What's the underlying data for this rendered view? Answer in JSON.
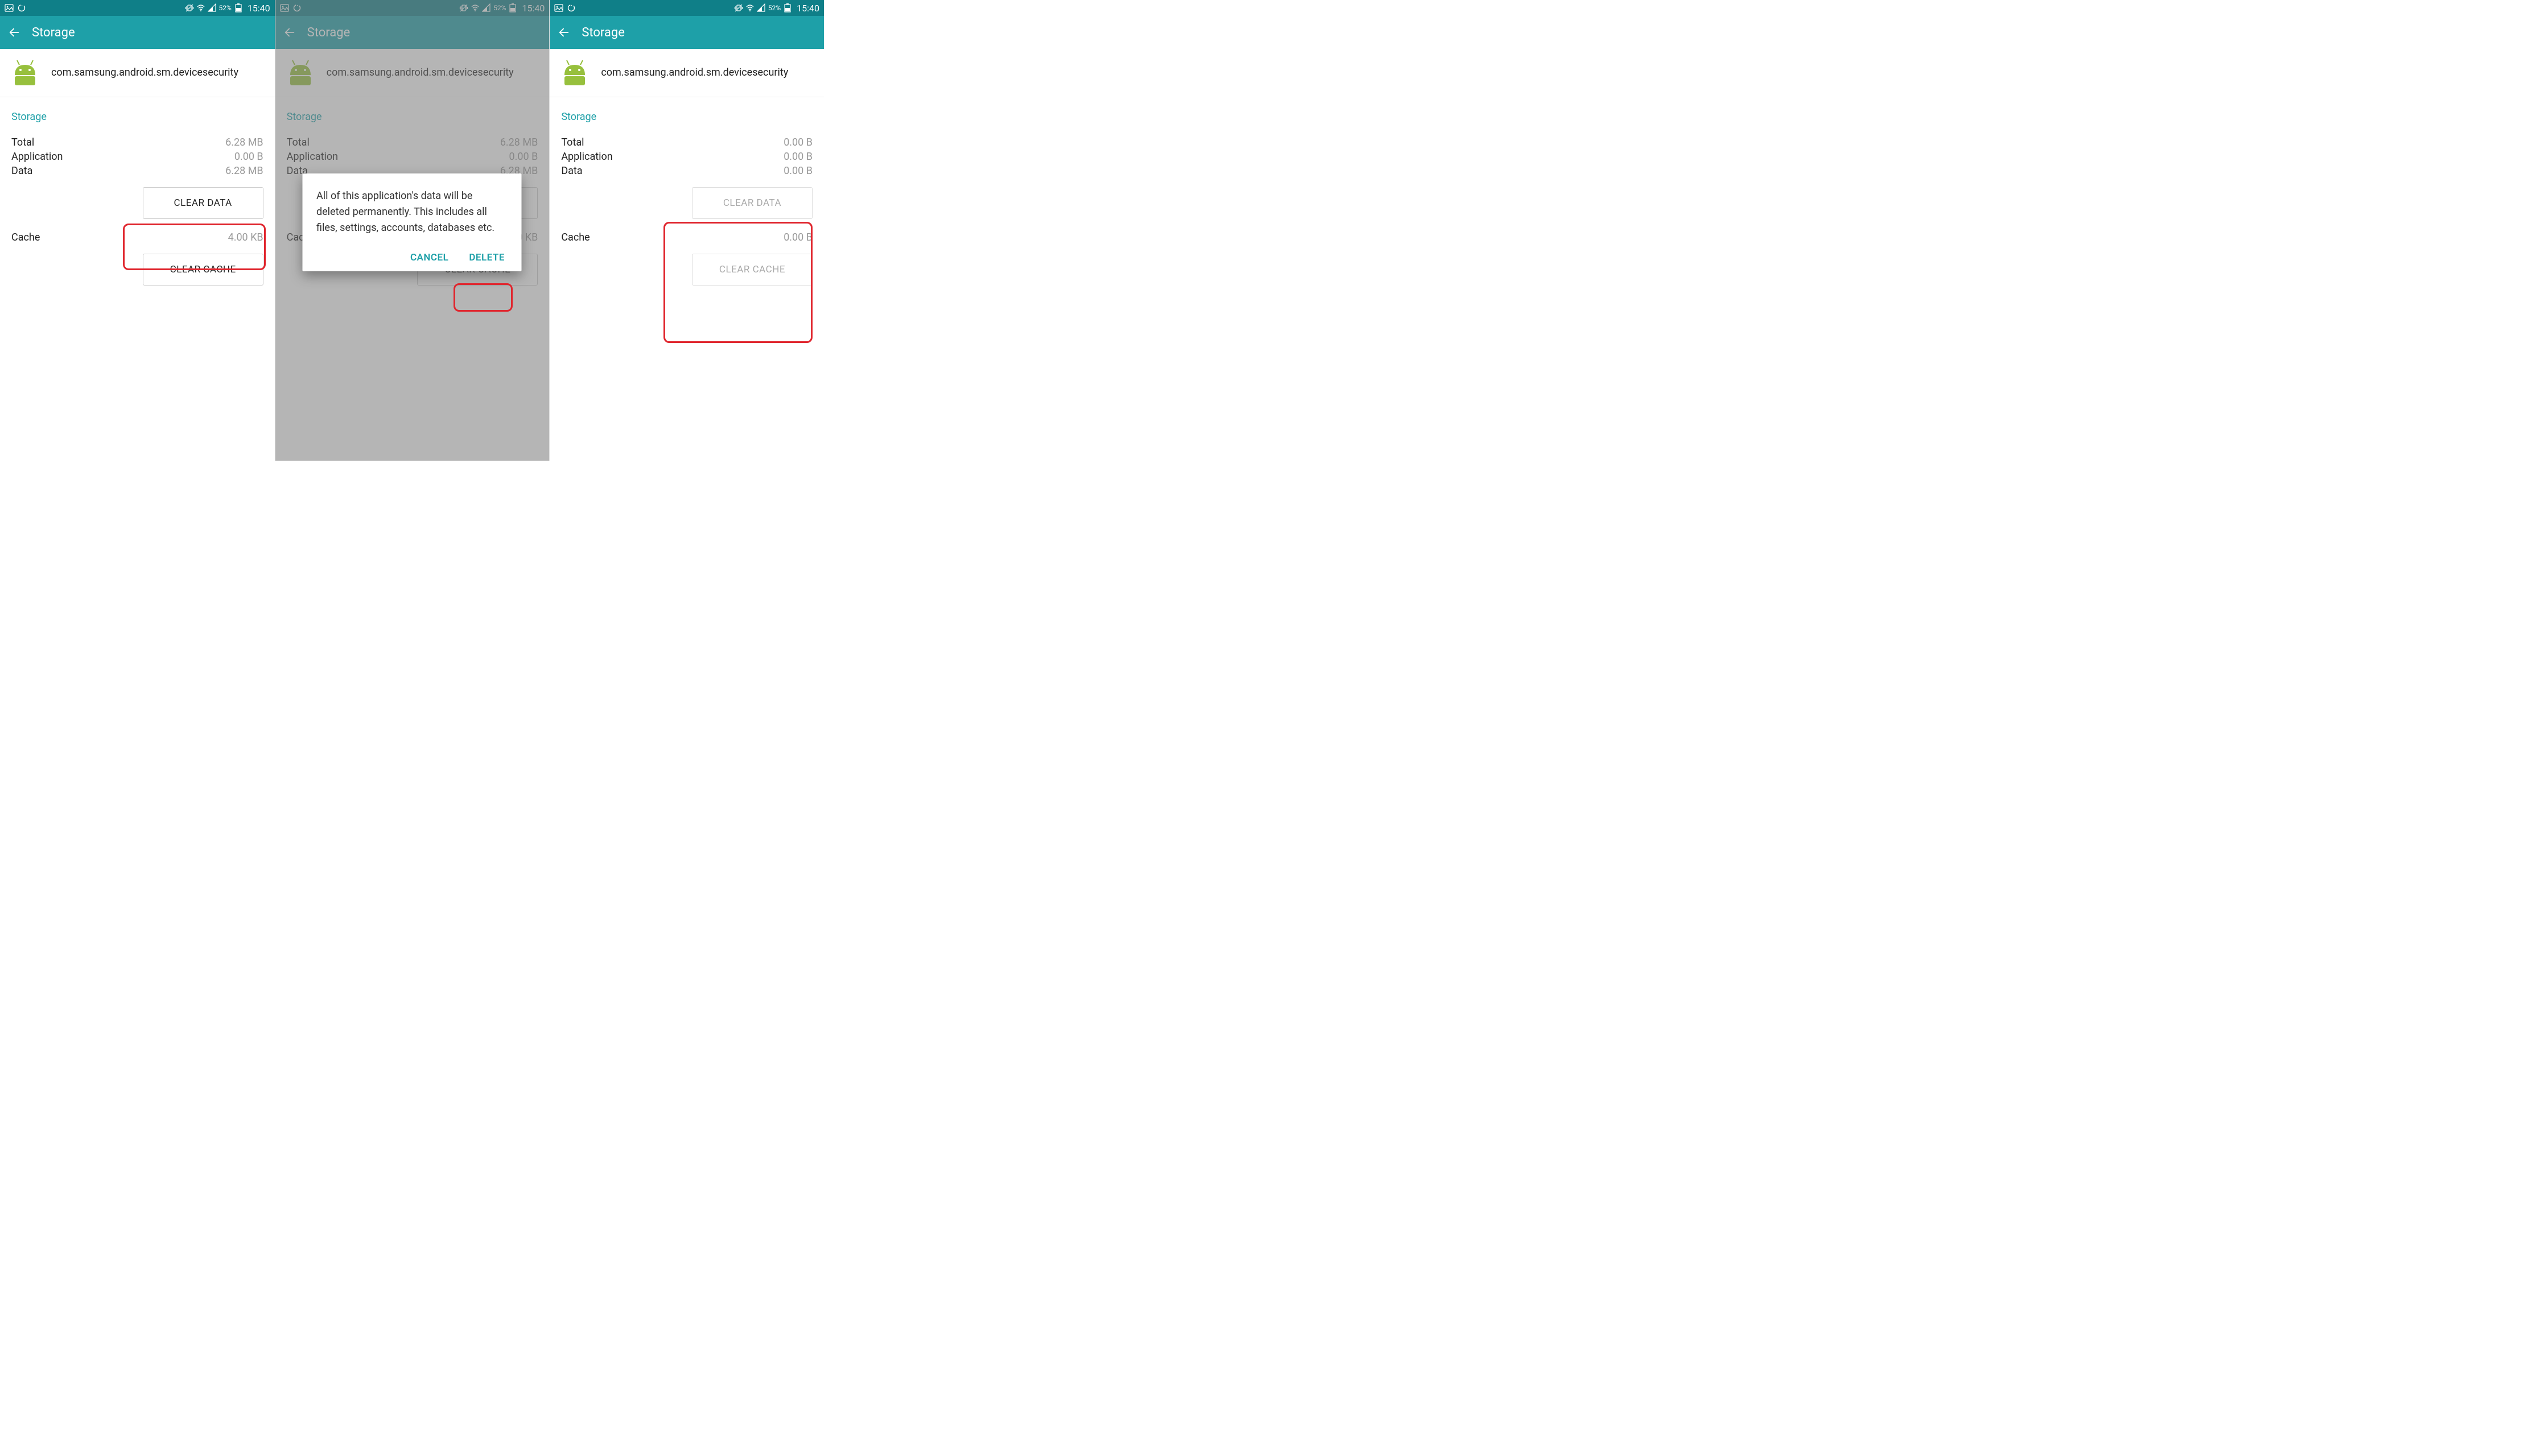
{
  "status": {
    "battery_pct": "52%",
    "clock": "15:40"
  },
  "appbar": {
    "title": "Storage"
  },
  "app_info": {
    "package_name": "com.samsung.android.sm.devicesecurity"
  },
  "storage_section_title": "Storage",
  "labels": {
    "total": "Total",
    "application": "Application",
    "data": "Data",
    "cache": "Cache"
  },
  "buttons": {
    "clear_data": "CLEAR DATA",
    "clear_cache": "CLEAR CACHE"
  },
  "dialog": {
    "message": "All of this application's data will be deleted permanently. This includes all files, settings, accounts, databases etc.",
    "cancel": "CANCEL",
    "delete": "DELETE"
  },
  "screen1": {
    "values": {
      "total": "6.28 MB",
      "application": "0.00 B",
      "data": "6.28 MB",
      "cache": "4.00 KB"
    }
  },
  "screen3": {
    "values": {
      "total": "0.00 B",
      "application": "0.00 B",
      "data": "0.00 B",
      "cache": "0.00 B"
    }
  }
}
